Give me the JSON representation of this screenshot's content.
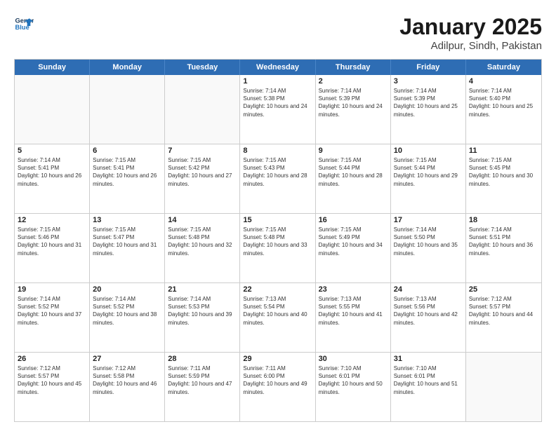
{
  "logo": {
    "line1": "General",
    "line2": "Blue"
  },
  "title": "January 2025",
  "subtitle": "Adilpur, Sindh, Pakistan",
  "header_days": [
    "Sunday",
    "Monday",
    "Tuesday",
    "Wednesday",
    "Thursday",
    "Friday",
    "Saturday"
  ],
  "weeks": [
    [
      {
        "day": "",
        "sunrise": "",
        "sunset": "",
        "daylight": "",
        "empty": true
      },
      {
        "day": "",
        "sunrise": "",
        "sunset": "",
        "daylight": "",
        "empty": true
      },
      {
        "day": "",
        "sunrise": "",
        "sunset": "",
        "daylight": "",
        "empty": true
      },
      {
        "day": "1",
        "sunrise": "Sunrise: 7:14 AM",
        "sunset": "Sunset: 5:38 PM",
        "daylight": "Daylight: 10 hours and 24 minutes."
      },
      {
        "day": "2",
        "sunrise": "Sunrise: 7:14 AM",
        "sunset": "Sunset: 5:39 PM",
        "daylight": "Daylight: 10 hours and 24 minutes."
      },
      {
        "day": "3",
        "sunrise": "Sunrise: 7:14 AM",
        "sunset": "Sunset: 5:39 PM",
        "daylight": "Daylight: 10 hours and 25 minutes."
      },
      {
        "day": "4",
        "sunrise": "Sunrise: 7:14 AM",
        "sunset": "Sunset: 5:40 PM",
        "daylight": "Daylight: 10 hours and 25 minutes."
      }
    ],
    [
      {
        "day": "5",
        "sunrise": "Sunrise: 7:14 AM",
        "sunset": "Sunset: 5:41 PM",
        "daylight": "Daylight: 10 hours and 26 minutes."
      },
      {
        "day": "6",
        "sunrise": "Sunrise: 7:15 AM",
        "sunset": "Sunset: 5:41 PM",
        "daylight": "Daylight: 10 hours and 26 minutes."
      },
      {
        "day": "7",
        "sunrise": "Sunrise: 7:15 AM",
        "sunset": "Sunset: 5:42 PM",
        "daylight": "Daylight: 10 hours and 27 minutes."
      },
      {
        "day": "8",
        "sunrise": "Sunrise: 7:15 AM",
        "sunset": "Sunset: 5:43 PM",
        "daylight": "Daylight: 10 hours and 28 minutes."
      },
      {
        "day": "9",
        "sunrise": "Sunrise: 7:15 AM",
        "sunset": "Sunset: 5:44 PM",
        "daylight": "Daylight: 10 hours and 28 minutes."
      },
      {
        "day": "10",
        "sunrise": "Sunrise: 7:15 AM",
        "sunset": "Sunset: 5:44 PM",
        "daylight": "Daylight: 10 hours and 29 minutes."
      },
      {
        "day": "11",
        "sunrise": "Sunrise: 7:15 AM",
        "sunset": "Sunset: 5:45 PM",
        "daylight": "Daylight: 10 hours and 30 minutes."
      }
    ],
    [
      {
        "day": "12",
        "sunrise": "Sunrise: 7:15 AM",
        "sunset": "Sunset: 5:46 PM",
        "daylight": "Daylight: 10 hours and 31 minutes."
      },
      {
        "day": "13",
        "sunrise": "Sunrise: 7:15 AM",
        "sunset": "Sunset: 5:47 PM",
        "daylight": "Daylight: 10 hours and 31 minutes."
      },
      {
        "day": "14",
        "sunrise": "Sunrise: 7:15 AM",
        "sunset": "Sunset: 5:48 PM",
        "daylight": "Daylight: 10 hours and 32 minutes."
      },
      {
        "day": "15",
        "sunrise": "Sunrise: 7:15 AM",
        "sunset": "Sunset: 5:48 PM",
        "daylight": "Daylight: 10 hours and 33 minutes."
      },
      {
        "day": "16",
        "sunrise": "Sunrise: 7:15 AM",
        "sunset": "Sunset: 5:49 PM",
        "daylight": "Daylight: 10 hours and 34 minutes."
      },
      {
        "day": "17",
        "sunrise": "Sunrise: 7:14 AM",
        "sunset": "Sunset: 5:50 PM",
        "daylight": "Daylight: 10 hours and 35 minutes."
      },
      {
        "day": "18",
        "sunrise": "Sunrise: 7:14 AM",
        "sunset": "Sunset: 5:51 PM",
        "daylight": "Daylight: 10 hours and 36 minutes."
      }
    ],
    [
      {
        "day": "19",
        "sunrise": "Sunrise: 7:14 AM",
        "sunset": "Sunset: 5:52 PM",
        "daylight": "Daylight: 10 hours and 37 minutes."
      },
      {
        "day": "20",
        "sunrise": "Sunrise: 7:14 AM",
        "sunset": "Sunset: 5:52 PM",
        "daylight": "Daylight: 10 hours and 38 minutes."
      },
      {
        "day": "21",
        "sunrise": "Sunrise: 7:14 AM",
        "sunset": "Sunset: 5:53 PM",
        "daylight": "Daylight: 10 hours and 39 minutes."
      },
      {
        "day": "22",
        "sunrise": "Sunrise: 7:13 AM",
        "sunset": "Sunset: 5:54 PM",
        "daylight": "Daylight: 10 hours and 40 minutes."
      },
      {
        "day": "23",
        "sunrise": "Sunrise: 7:13 AM",
        "sunset": "Sunset: 5:55 PM",
        "daylight": "Daylight: 10 hours and 41 minutes."
      },
      {
        "day": "24",
        "sunrise": "Sunrise: 7:13 AM",
        "sunset": "Sunset: 5:56 PM",
        "daylight": "Daylight: 10 hours and 42 minutes."
      },
      {
        "day": "25",
        "sunrise": "Sunrise: 7:12 AM",
        "sunset": "Sunset: 5:57 PM",
        "daylight": "Daylight: 10 hours and 44 minutes."
      }
    ],
    [
      {
        "day": "26",
        "sunrise": "Sunrise: 7:12 AM",
        "sunset": "Sunset: 5:57 PM",
        "daylight": "Daylight: 10 hours and 45 minutes."
      },
      {
        "day": "27",
        "sunrise": "Sunrise: 7:12 AM",
        "sunset": "Sunset: 5:58 PM",
        "daylight": "Daylight: 10 hours and 46 minutes."
      },
      {
        "day": "28",
        "sunrise": "Sunrise: 7:11 AM",
        "sunset": "Sunset: 5:59 PM",
        "daylight": "Daylight: 10 hours and 47 minutes."
      },
      {
        "day": "29",
        "sunrise": "Sunrise: 7:11 AM",
        "sunset": "Sunset: 6:00 PM",
        "daylight": "Daylight: 10 hours and 49 minutes."
      },
      {
        "day": "30",
        "sunrise": "Sunrise: 7:10 AM",
        "sunset": "Sunset: 6:01 PM",
        "daylight": "Daylight: 10 hours and 50 minutes."
      },
      {
        "day": "31",
        "sunrise": "Sunrise: 7:10 AM",
        "sunset": "Sunset: 6:01 PM",
        "daylight": "Daylight: 10 hours and 51 minutes."
      },
      {
        "day": "",
        "sunrise": "",
        "sunset": "",
        "daylight": "",
        "empty": true
      }
    ]
  ]
}
